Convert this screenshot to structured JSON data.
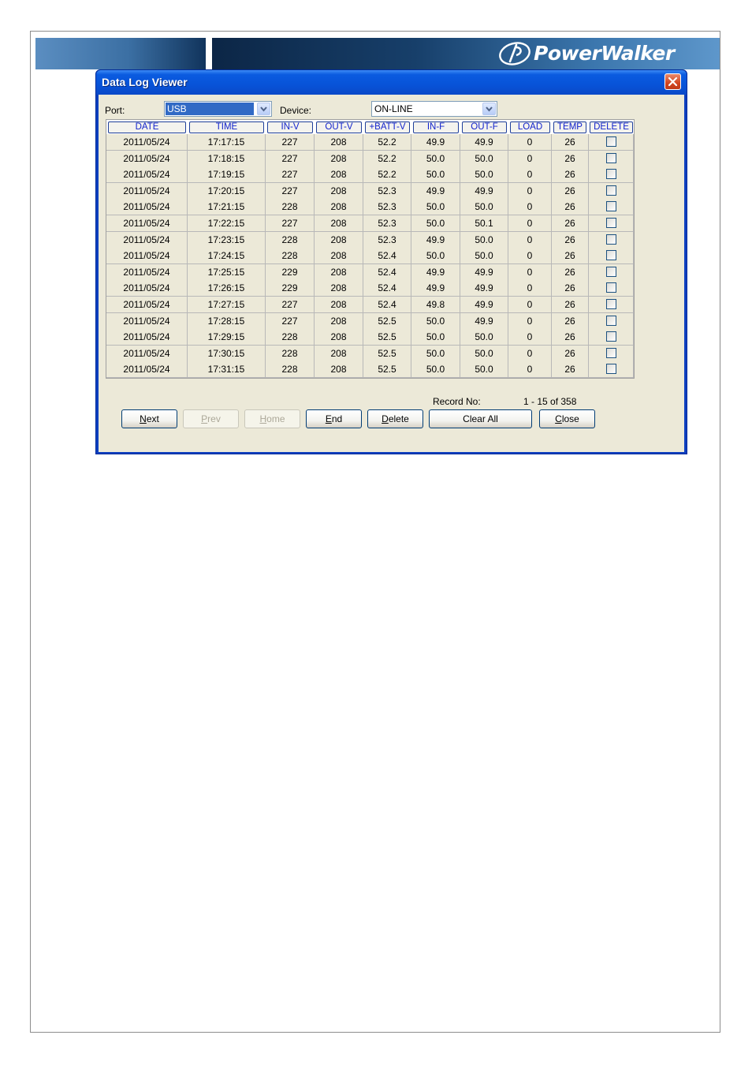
{
  "banner": {
    "brand": "PowerWalker"
  },
  "window": {
    "title": "Data Log Viewer"
  },
  "port": {
    "label": "Port:",
    "value": "USB"
  },
  "device": {
    "label": "Device:",
    "value": "ON-LINE"
  },
  "columns": [
    "DATE",
    "TIME",
    "IN-V",
    "OUT-V",
    "+BATT-V",
    "IN-F",
    "OUT-F",
    "LOAD",
    "TEMP",
    "DELETE"
  ],
  "rows": [
    {
      "date": "2011/05/24",
      "time": "17:17:15",
      "in_v": "227",
      "out_v": "208",
      "batt_v": "52.2",
      "in_f": "49.9",
      "out_f": "49.9",
      "load": "0",
      "temp": "26",
      "delete": false
    },
    {
      "date": "2011/05/24",
      "time": "17:18:15",
      "in_v": "227",
      "out_v": "208",
      "batt_v": "52.2",
      "in_f": "50.0",
      "out_f": "50.0",
      "load": "0",
      "temp": "26",
      "delete": false
    },
    {
      "date": "2011/05/24",
      "time": "17:19:15",
      "in_v": "227",
      "out_v": "208",
      "batt_v": "52.2",
      "in_f": "50.0",
      "out_f": "50.0",
      "load": "0",
      "temp": "26",
      "delete": false
    },
    {
      "date": "2011/05/24",
      "time": "17:20:15",
      "in_v": "227",
      "out_v": "208",
      "batt_v": "52.3",
      "in_f": "49.9",
      "out_f": "49.9",
      "load": "0",
      "temp": "26",
      "delete": false
    },
    {
      "date": "2011/05/24",
      "time": "17:21:15",
      "in_v": "228",
      "out_v": "208",
      "batt_v": "52.3",
      "in_f": "50.0",
      "out_f": "50.0",
      "load": "0",
      "temp": "26",
      "delete": false
    },
    {
      "date": "2011/05/24",
      "time": "17:22:15",
      "in_v": "227",
      "out_v": "208",
      "batt_v": "52.3",
      "in_f": "50.0",
      "out_f": "50.1",
      "load": "0",
      "temp": "26",
      "delete": false
    },
    {
      "date": "2011/05/24",
      "time": "17:23:15",
      "in_v": "228",
      "out_v": "208",
      "batt_v": "52.3",
      "in_f": "49.9",
      "out_f": "50.0",
      "load": "0",
      "temp": "26",
      "delete": false
    },
    {
      "date": "2011/05/24",
      "time": "17:24:15",
      "in_v": "228",
      "out_v": "208",
      "batt_v": "52.4",
      "in_f": "50.0",
      "out_f": "50.0",
      "load": "0",
      "temp": "26",
      "delete": false
    },
    {
      "date": "2011/05/24",
      "time": "17:25:15",
      "in_v": "229",
      "out_v": "208",
      "batt_v": "52.4",
      "in_f": "49.9",
      "out_f": "49.9",
      "load": "0",
      "temp": "26",
      "delete": false
    },
    {
      "date": "2011/05/24",
      "time": "17:26:15",
      "in_v": "229",
      "out_v": "208",
      "batt_v": "52.4",
      "in_f": "49.9",
      "out_f": "49.9",
      "load": "0",
      "temp": "26",
      "delete": false
    },
    {
      "date": "2011/05/24",
      "time": "17:27:15",
      "in_v": "227",
      "out_v": "208",
      "batt_v": "52.4",
      "in_f": "49.8",
      "out_f": "49.9",
      "load": "0",
      "temp": "26",
      "delete": false
    },
    {
      "date": "2011/05/24",
      "time": "17:28:15",
      "in_v": "227",
      "out_v": "208",
      "batt_v": "52.5",
      "in_f": "50.0",
      "out_f": "49.9",
      "load": "0",
      "temp": "26",
      "delete": false
    },
    {
      "date": "2011/05/24",
      "time": "17:29:15",
      "in_v": "228",
      "out_v": "208",
      "batt_v": "52.5",
      "in_f": "50.0",
      "out_f": "50.0",
      "load": "0",
      "temp": "26",
      "delete": false
    },
    {
      "date": "2011/05/24",
      "time": "17:30:15",
      "in_v": "228",
      "out_v": "208",
      "batt_v": "52.5",
      "in_f": "50.0",
      "out_f": "50.0",
      "load": "0",
      "temp": "26",
      "delete": false
    },
    {
      "date": "2011/05/24",
      "time": "17:31:15",
      "in_v": "228",
      "out_v": "208",
      "batt_v": "52.5",
      "in_f": "50.0",
      "out_f": "50.0",
      "load": "0",
      "temp": "26",
      "delete": false
    }
  ],
  "record": {
    "label": "Record No:",
    "value": "1 - 15 of 358"
  },
  "buttons": {
    "next": {
      "pre": "",
      "key": "N",
      "post": "ext",
      "enabled": true
    },
    "prev": {
      "pre": "",
      "key": "P",
      "post": "rev",
      "enabled": false
    },
    "home": {
      "pre": "",
      "key": "H",
      "post": "ome",
      "enabled": false
    },
    "end": {
      "pre": "",
      "key": "E",
      "post": "nd",
      "enabled": true
    },
    "delete": {
      "pre": "",
      "key": "D",
      "post": "elete",
      "enabled": true
    },
    "clear_all": {
      "label": "Clear All",
      "enabled": true
    },
    "close": {
      "pre": "",
      "key": "C",
      "post": "lose",
      "enabled": true
    }
  },
  "colors": {
    "title_bar": "#0853d8",
    "header_text": "#1122cc",
    "dialog_bg": "#ece9d8",
    "selected_bg": "#316ac5"
  }
}
